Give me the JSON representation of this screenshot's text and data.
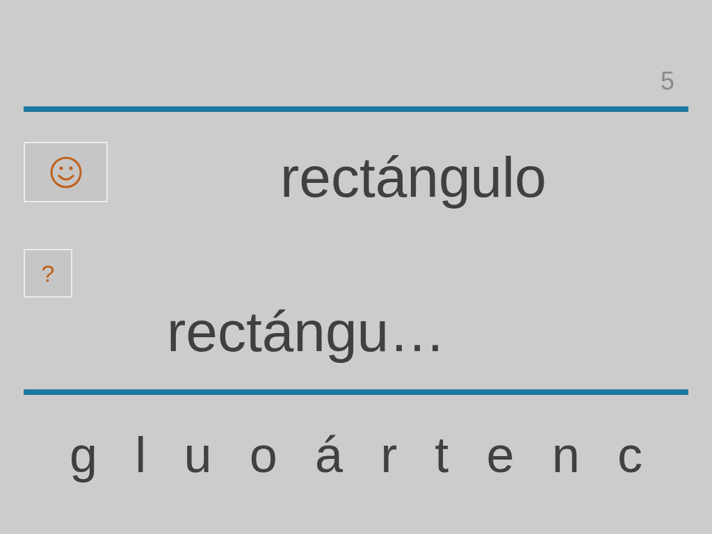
{
  "page_number": "5",
  "word": "rectángulo",
  "hint_button": "?",
  "answer": "rectángu…",
  "letters": [
    "g",
    "l",
    "u",
    "o",
    "á",
    "r",
    "t",
    "e",
    "n",
    "c"
  ]
}
